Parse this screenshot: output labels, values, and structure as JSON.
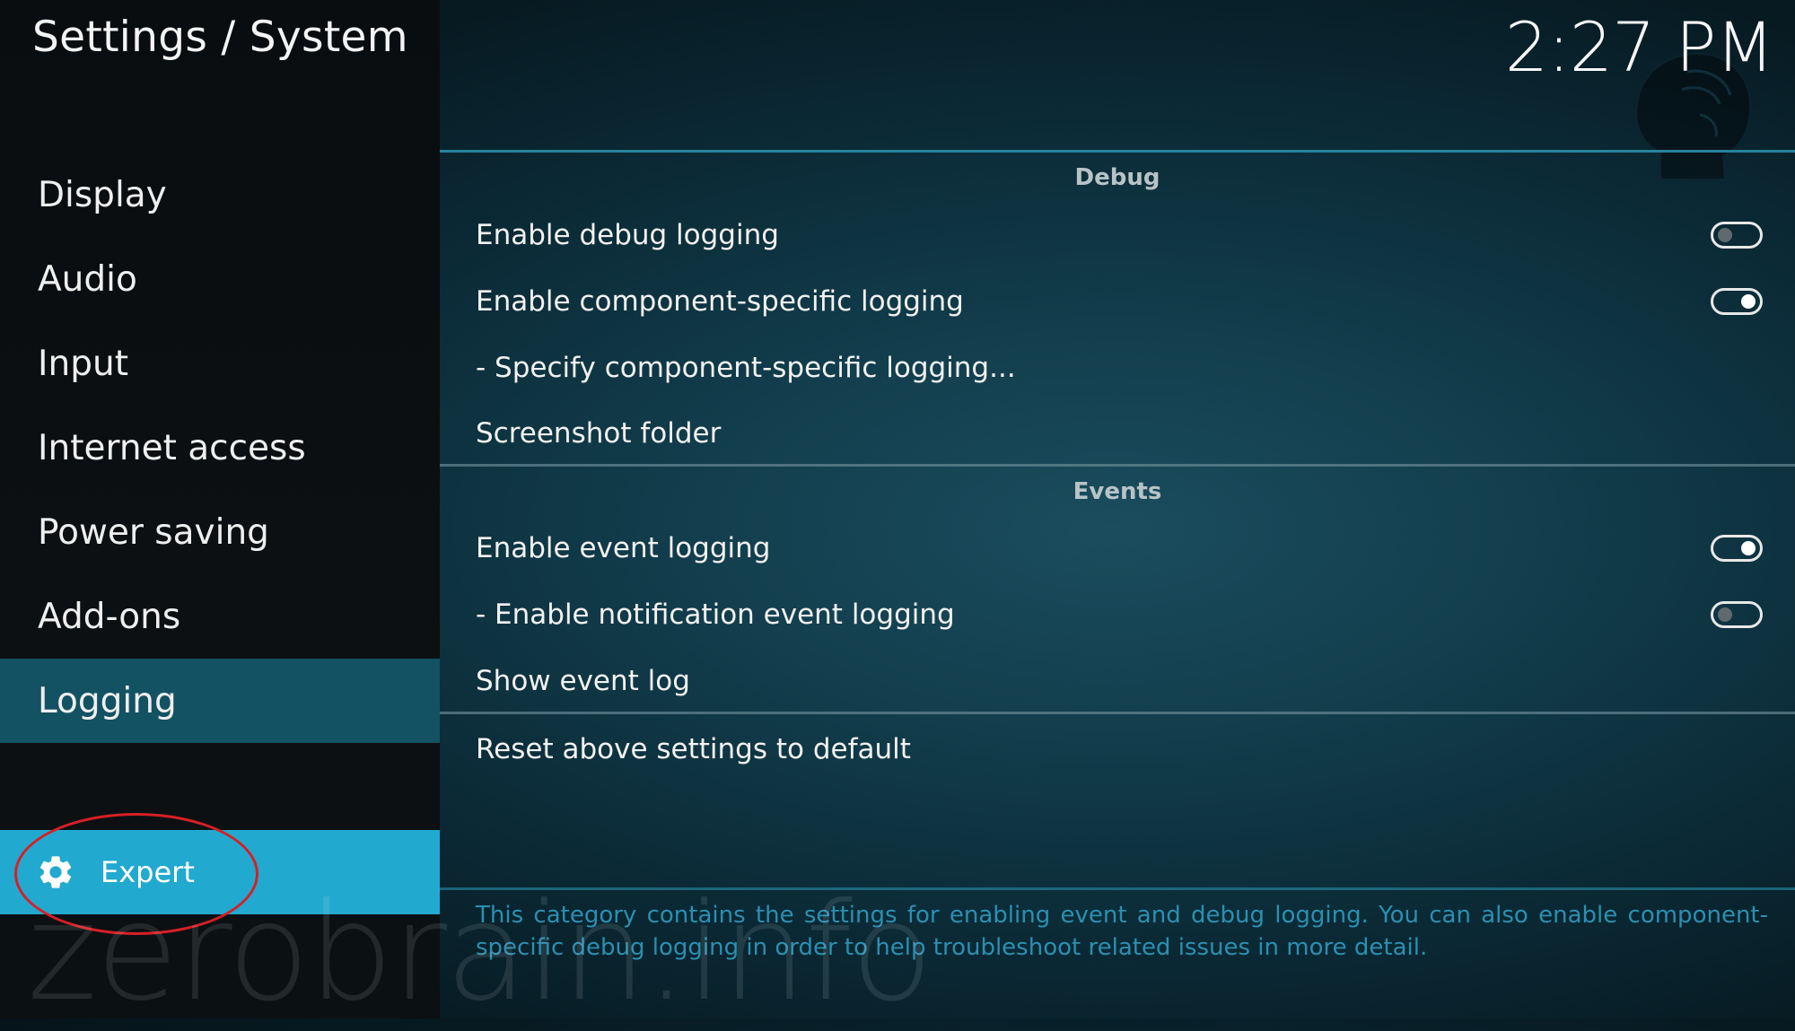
{
  "header": {
    "title": "Settings / System",
    "clock": "2:27 PM"
  },
  "sidebar": {
    "items": [
      {
        "label": "Display",
        "active": false
      },
      {
        "label": "Audio",
        "active": false
      },
      {
        "label": "Input",
        "active": false
      },
      {
        "label": "Internet access",
        "active": false
      },
      {
        "label": "Power saving",
        "active": false
      },
      {
        "label": "Add-ons",
        "active": false
      },
      {
        "label": "Logging",
        "active": true
      }
    ],
    "level_button": {
      "label": "Expert",
      "icon": "gear-icon"
    }
  },
  "sections": {
    "debug": {
      "header": "Debug",
      "settings": [
        {
          "label": "Enable debug logging",
          "toggle": "off"
        },
        {
          "label": "Enable component-specific logging",
          "toggle": "on"
        },
        {
          "label": "- Specify component-specific logging..."
        },
        {
          "label": "Screenshot folder"
        }
      ]
    },
    "events": {
      "header": "Events",
      "settings": [
        {
          "label": "Enable event logging",
          "toggle": "on"
        },
        {
          "label": "- Enable notification event logging",
          "toggle": "off"
        },
        {
          "label": "Show event log"
        }
      ]
    },
    "reset_label": "Reset above settings to default"
  },
  "description": "This category contains the settings for enabling event and debug logging. You can also enable component-specific debug logging in order to help troubleshoot related issues in more detail.",
  "watermark": "zerobrain.info",
  "colors": {
    "accent": "#22a9cf",
    "active_item": "#135263",
    "annotation": "#d61f26",
    "description_text": "#2c8fb0"
  }
}
